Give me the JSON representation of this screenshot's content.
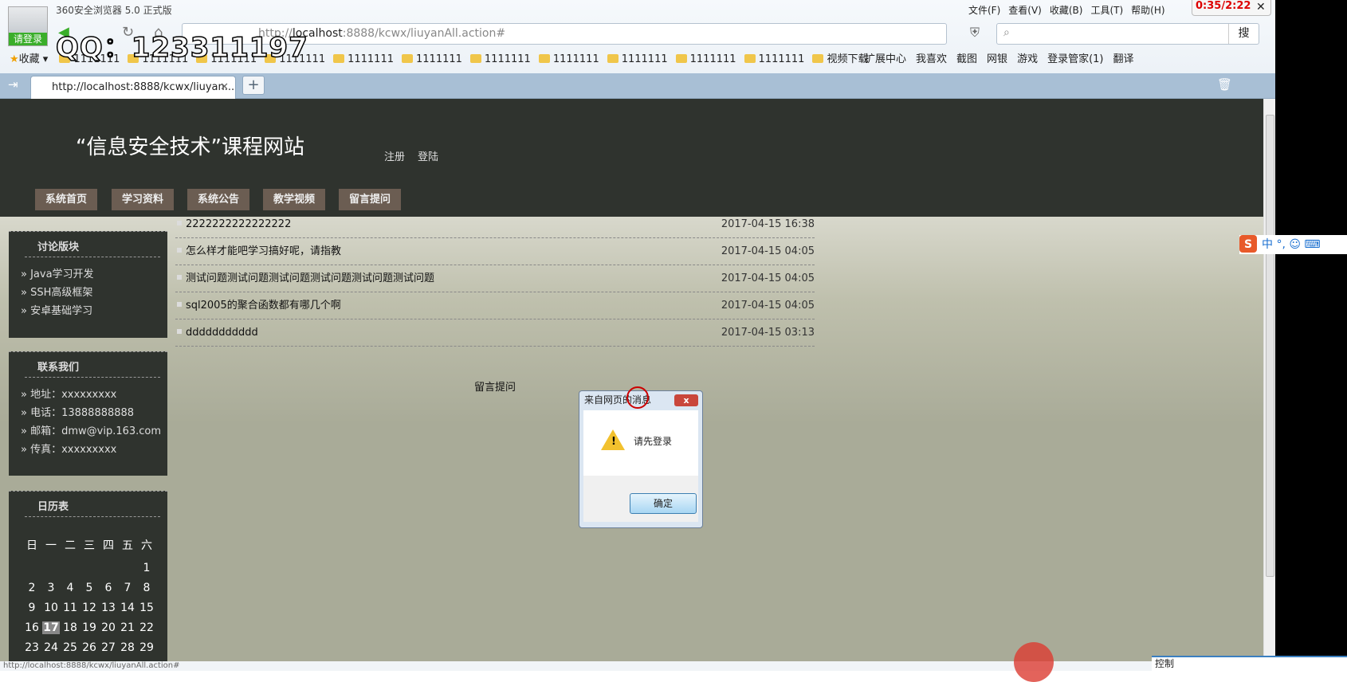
{
  "browser": {
    "title": "360安全浏览器 5.0 正式版",
    "login_label": "请登录",
    "menu": [
      "文件(F)",
      "查看(V)",
      "收藏(B)",
      "工具(T)",
      "帮助(H)"
    ],
    "address_prefix": "http://",
    "address_host": "localhost",
    "address_rest": ":8888/kcwx/liuyanAll.action#",
    "search_button": "搜",
    "favorites_label": "收藏",
    "bookmarks": [
      "1111111",
      "1111111",
      "1111111",
      "1111111",
      "1111111",
      "1111111",
      "1111111",
      "1111111",
      "1111111",
      "1111111",
      "1111111",
      "视频下载"
    ],
    "toolbar_right": [
      "扩展中心",
      "我喜欢",
      "截图",
      "网银",
      "游戏",
      "登录管家(1)",
      "翻译"
    ],
    "tab_title": "http://localhost:8888/kcwx/liuyan...",
    "status_url": "http://localhost:8888/kcwx/liuyanAll.action#"
  },
  "overlay": {
    "watermark": "QQ：123311197",
    "timer": "0:35/2:22",
    "control_label": "控制",
    "ime": "中 °,"
  },
  "site": {
    "title": "“信息安全技术”课程网站",
    "top_links": [
      "注册",
      "登陆"
    ],
    "nav": [
      "系统首页",
      "学习资料",
      "系统公告",
      "教学视频",
      "留言提问"
    ]
  },
  "sidebar": {
    "forum": {
      "title": "讨论版块",
      "items": [
        "» Java学习开发",
        "» SSH高级框架",
        "» 安卓基础学习"
      ]
    },
    "contact": {
      "title": "联系我们",
      "items": [
        "» 地址：xxxxxxxxx",
        "» 电话：13888888888",
        "» 邮箱：dmw@vip.163.com",
        "» 传真：xxxxxxxxx"
      ]
    },
    "calendar": {
      "title": "日历表",
      "weekdays": [
        "日",
        "一",
        "二",
        "三",
        "四",
        "五",
        "六"
      ],
      "first_weekday": 6,
      "days": 29,
      "today": 17
    }
  },
  "posts": [
    {
      "title": "2222222222222222",
      "date": "2017-04-15 16:38"
    },
    {
      "title": "怎么样才能吧学习搞好呢，请指教",
      "date": "2017-04-15 04:05"
    },
    {
      "title": "测试问题测试问题测试问题测试问题测试问题测试问题",
      "date": "2017-04-15 04:05"
    },
    {
      "title": "sql2005的聚合函数都有哪几个啊",
      "date": "2017-04-15 04:05"
    },
    {
      "title": "ddddddddddd",
      "date": "2017-04-15 03:13"
    }
  ],
  "post_link": "留言提问",
  "dialog": {
    "title": "来自网页的消息",
    "message": "请先登录",
    "ok": "确定"
  }
}
